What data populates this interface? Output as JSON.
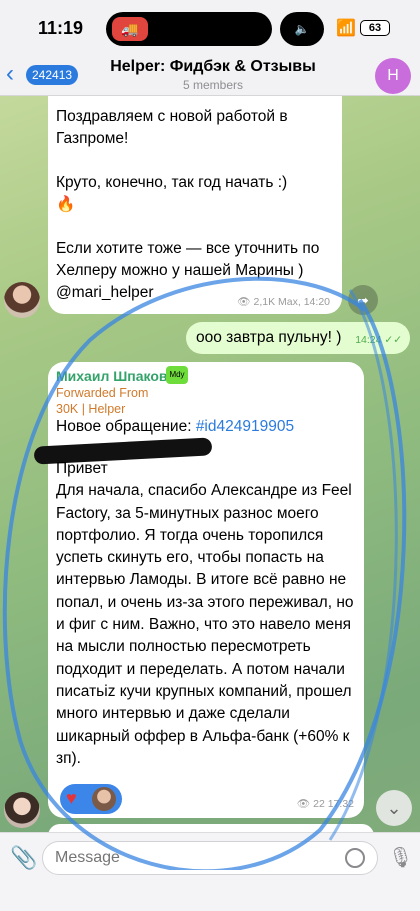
{
  "status": {
    "time": "11:19",
    "battery": "63"
  },
  "header": {
    "back_badge": "242413",
    "title": "Helper: Фидбэк & Отзывы",
    "subtitle": "5 members",
    "avatar_letter": "H"
  },
  "msg1": {
    "text": "Поздравляем с новой работой в Газпроме!\n\nКруто, конечно, так год начать :)\n🔥\n\nЕсли хотите тоже — все уточнить по Хелперу можно у нашей Марины ) @mari_helper",
    "meta": "👁 2,1K Max, 14:20"
  },
  "out": {
    "text": "ооо завтра пульну! )",
    "time": "14:24 ✓✓"
  },
  "msg2": {
    "sender": "Михаил Шпаков",
    "badge": "Mdy",
    "forwarded": "Forwarded From",
    "forward_source": "30K | Helper",
    "subject_prefix": "Новое обращение: ",
    "subject_tag": "#id424919905",
    "body": "Привет\nДля начала, спасибо Александре из Feel Factory, за 5-минутных разнос моего портфолио. Я тогда очень торопился успеть скинуть его, чтобы попасть на интервью Ламоды. В итоге всё равно не попал, и очень из-за этого переживал, но и фиг с ним. Важно, что это навело меня на мысли полностью пересмотреть подходит и переделать. А потом начали писатьiz кучи крупных компаний, прошел много интервью и даже сделали шикарный оффер в Альфа-банк (+60% к зп).",
    "meta": "👁 22 17:32"
  },
  "input": {
    "placeholder": "Message"
  },
  "icons": {
    "back": "chevron-left-icon",
    "attach": "paperclip-icon",
    "sticker": "sticker-icon",
    "mic": "microphone-icon",
    "share": "share-icon",
    "scroll_down": "chevron-down-icon"
  }
}
